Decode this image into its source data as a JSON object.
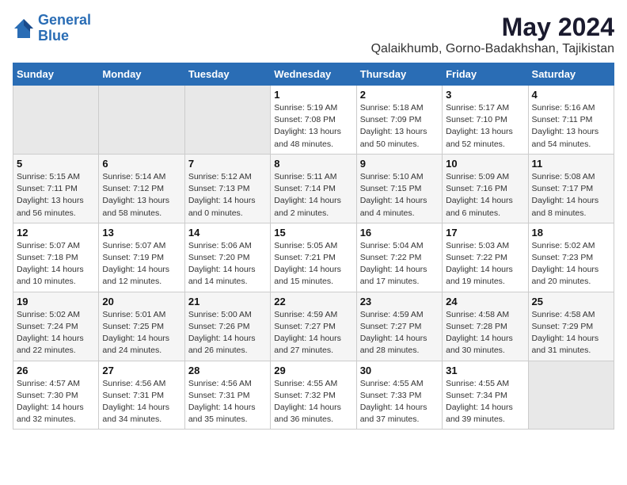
{
  "header": {
    "logo_line1": "General",
    "logo_line2": "Blue",
    "title": "May 2024",
    "subtitle": "Qalaikhumb, Gorno-Badakhshan, Tajikistan"
  },
  "weekdays": [
    "Sunday",
    "Monday",
    "Tuesday",
    "Wednesday",
    "Thursday",
    "Friday",
    "Saturday"
  ],
  "weeks": [
    [
      {
        "day": "",
        "info": ""
      },
      {
        "day": "",
        "info": ""
      },
      {
        "day": "",
        "info": ""
      },
      {
        "day": "1",
        "info": "Sunrise: 5:19 AM\nSunset: 7:08 PM\nDaylight: 13 hours\nand 48 minutes."
      },
      {
        "day": "2",
        "info": "Sunrise: 5:18 AM\nSunset: 7:09 PM\nDaylight: 13 hours\nand 50 minutes."
      },
      {
        "day": "3",
        "info": "Sunrise: 5:17 AM\nSunset: 7:10 PM\nDaylight: 13 hours\nand 52 minutes."
      },
      {
        "day": "4",
        "info": "Sunrise: 5:16 AM\nSunset: 7:11 PM\nDaylight: 13 hours\nand 54 minutes."
      }
    ],
    [
      {
        "day": "5",
        "info": "Sunrise: 5:15 AM\nSunset: 7:11 PM\nDaylight: 13 hours\nand 56 minutes."
      },
      {
        "day": "6",
        "info": "Sunrise: 5:14 AM\nSunset: 7:12 PM\nDaylight: 13 hours\nand 58 minutes."
      },
      {
        "day": "7",
        "info": "Sunrise: 5:12 AM\nSunset: 7:13 PM\nDaylight: 14 hours\nand 0 minutes."
      },
      {
        "day": "8",
        "info": "Sunrise: 5:11 AM\nSunset: 7:14 PM\nDaylight: 14 hours\nand 2 minutes."
      },
      {
        "day": "9",
        "info": "Sunrise: 5:10 AM\nSunset: 7:15 PM\nDaylight: 14 hours\nand 4 minutes."
      },
      {
        "day": "10",
        "info": "Sunrise: 5:09 AM\nSunset: 7:16 PM\nDaylight: 14 hours\nand 6 minutes."
      },
      {
        "day": "11",
        "info": "Sunrise: 5:08 AM\nSunset: 7:17 PM\nDaylight: 14 hours\nand 8 minutes."
      }
    ],
    [
      {
        "day": "12",
        "info": "Sunrise: 5:07 AM\nSunset: 7:18 PM\nDaylight: 14 hours\nand 10 minutes."
      },
      {
        "day": "13",
        "info": "Sunrise: 5:07 AM\nSunset: 7:19 PM\nDaylight: 14 hours\nand 12 minutes."
      },
      {
        "day": "14",
        "info": "Sunrise: 5:06 AM\nSunset: 7:20 PM\nDaylight: 14 hours\nand 14 minutes."
      },
      {
        "day": "15",
        "info": "Sunrise: 5:05 AM\nSunset: 7:21 PM\nDaylight: 14 hours\nand 15 minutes."
      },
      {
        "day": "16",
        "info": "Sunrise: 5:04 AM\nSunset: 7:22 PM\nDaylight: 14 hours\nand 17 minutes."
      },
      {
        "day": "17",
        "info": "Sunrise: 5:03 AM\nSunset: 7:22 PM\nDaylight: 14 hours\nand 19 minutes."
      },
      {
        "day": "18",
        "info": "Sunrise: 5:02 AM\nSunset: 7:23 PM\nDaylight: 14 hours\nand 20 minutes."
      }
    ],
    [
      {
        "day": "19",
        "info": "Sunrise: 5:02 AM\nSunset: 7:24 PM\nDaylight: 14 hours\nand 22 minutes."
      },
      {
        "day": "20",
        "info": "Sunrise: 5:01 AM\nSunset: 7:25 PM\nDaylight: 14 hours\nand 24 minutes."
      },
      {
        "day": "21",
        "info": "Sunrise: 5:00 AM\nSunset: 7:26 PM\nDaylight: 14 hours\nand 26 minutes."
      },
      {
        "day": "22",
        "info": "Sunrise: 4:59 AM\nSunset: 7:27 PM\nDaylight: 14 hours\nand 27 minutes."
      },
      {
        "day": "23",
        "info": "Sunrise: 4:59 AM\nSunset: 7:27 PM\nDaylight: 14 hours\nand 28 minutes."
      },
      {
        "day": "24",
        "info": "Sunrise: 4:58 AM\nSunset: 7:28 PM\nDaylight: 14 hours\nand 30 minutes."
      },
      {
        "day": "25",
        "info": "Sunrise: 4:58 AM\nSunset: 7:29 PM\nDaylight: 14 hours\nand 31 minutes."
      }
    ],
    [
      {
        "day": "26",
        "info": "Sunrise: 4:57 AM\nSunset: 7:30 PM\nDaylight: 14 hours\nand 32 minutes."
      },
      {
        "day": "27",
        "info": "Sunrise: 4:56 AM\nSunset: 7:31 PM\nDaylight: 14 hours\nand 34 minutes."
      },
      {
        "day": "28",
        "info": "Sunrise: 4:56 AM\nSunset: 7:31 PM\nDaylight: 14 hours\nand 35 minutes."
      },
      {
        "day": "29",
        "info": "Sunrise: 4:55 AM\nSunset: 7:32 PM\nDaylight: 14 hours\nand 36 minutes."
      },
      {
        "day": "30",
        "info": "Sunrise: 4:55 AM\nSunset: 7:33 PM\nDaylight: 14 hours\nand 37 minutes."
      },
      {
        "day": "31",
        "info": "Sunrise: 4:55 AM\nSunset: 7:34 PM\nDaylight: 14 hours\nand 39 minutes."
      },
      {
        "day": "",
        "info": ""
      }
    ]
  ]
}
